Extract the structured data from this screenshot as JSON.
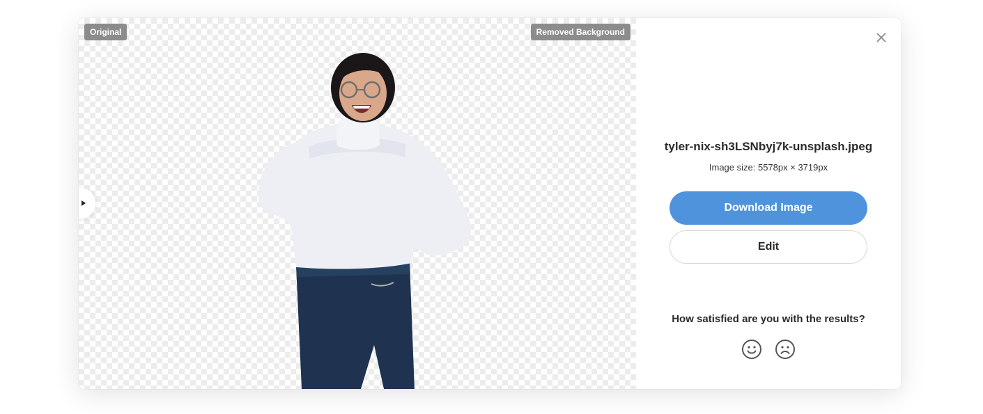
{
  "preview": {
    "tag_original": "Original",
    "tag_removed": "Removed Background"
  },
  "panel": {
    "filename": "tyler-nix-sh3LSNbyj7k-unsplash.jpeg",
    "image_size": "Image size: 5578px × 3719px",
    "download_label": "Download Image",
    "edit_label": "Edit",
    "question": "How satisfied are you with the results?"
  },
  "icons": {
    "close": "close-icon",
    "handle": "play-arrow-icon",
    "happy": "smiley-happy-icon",
    "sad": "smiley-sad-icon"
  },
  "colors": {
    "primary": "#4f93dc",
    "tag_bg": "#8c8c8c"
  }
}
